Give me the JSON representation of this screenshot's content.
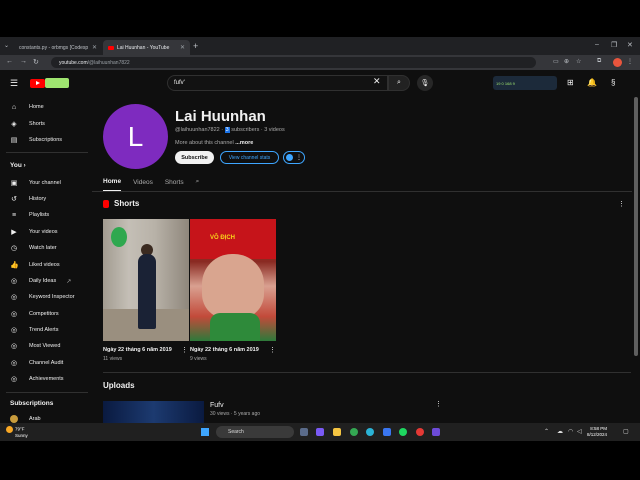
{
  "browser": {
    "tabs": [
      {
        "title": "constants.py - orbmgs [Codesp",
        "active": false
      },
      {
        "title": "Lai Huunhan - YouTube",
        "active": true
      }
    ],
    "new_tab": "+",
    "window_controls": [
      "–",
      "❐",
      "✕"
    ],
    "address": {
      "host": "youtube.com",
      "path": "/@laihuunhan7822"
    }
  },
  "yt_header": {
    "search_query": "fufv'",
    "clear": "✕",
    "ext_stats": "19  0  168  9"
  },
  "sidebar": {
    "top": [
      {
        "label": "Home",
        "icon": "home-icon",
        "glyph": "⌂"
      },
      {
        "label": "Shorts",
        "icon": "shorts-icon",
        "glyph": "◈"
      },
      {
        "label": "Subscriptions",
        "icon": "subscriptions-icon",
        "glyph": "▤"
      }
    ],
    "you_header": "You",
    "you_items": [
      {
        "label": "Your channel",
        "icon": "channel-icon",
        "glyph": "▣"
      },
      {
        "label": "History",
        "icon": "history-icon",
        "glyph": "↺"
      },
      {
        "label": "Playlists",
        "icon": "playlists-icon",
        "glyph": "≡"
      },
      {
        "label": "Your videos",
        "icon": "videos-icon",
        "glyph": "▶"
      },
      {
        "label": "Watch later",
        "icon": "clock-icon",
        "glyph": "◷"
      },
      {
        "label": "Liked videos",
        "icon": "like-icon",
        "glyph": "👍"
      },
      {
        "label": "Daily Ideas",
        "icon": "ideas-icon",
        "glyph": "◎"
      },
      {
        "label": "Keyword Inspector",
        "icon": "keyword-icon",
        "glyph": "◎"
      },
      {
        "label": "Competitors",
        "icon": "competitors-icon",
        "glyph": "◎"
      },
      {
        "label": "Trend Alerts",
        "icon": "trend-icon",
        "glyph": "◎"
      },
      {
        "label": "Most Viewed",
        "icon": "most-viewed-icon",
        "glyph": "◎"
      },
      {
        "label": "Channel Audit",
        "icon": "audit-icon",
        "glyph": "◎"
      },
      {
        "label": "Achievements",
        "icon": "achievements-icon",
        "glyph": "◎"
      }
    ],
    "subs_header": "Subscriptions",
    "subs_items": [
      {
        "label": "Arab"
      }
    ]
  },
  "channel": {
    "avatar_letter": "L",
    "name": "Lai Huunhan",
    "handle": "@laihuunhan7822 · ",
    "subscriber_count": "3",
    "meta_rest": " subscribers · 3 videos",
    "about": "More about this channel ",
    "more": "...more",
    "subscribe": "Subscribe",
    "view_stats": "View channel stats"
  },
  "tabs": [
    "Home",
    "Videos",
    "Shorts"
  ],
  "shorts_section": {
    "heading": "Shorts",
    "items": [
      {
        "title": "Ngày 22 tháng 6 năm 2019",
        "views": "11 views"
      },
      {
        "title": "Ngày 22 tháng 6 năm 2019",
        "views": "9 views",
        "overlay": "VÔ ĐỊCH"
      }
    ]
  },
  "uploads_section": {
    "heading": "Uploads",
    "items": [
      {
        "title": "Fufv",
        "meta": "30 views · 5 years ago"
      }
    ]
  },
  "taskbar": {
    "temp": "79°F",
    "weather": "Sunny",
    "search": "Search",
    "time": "8:58 PM",
    "date": "8/12/2024"
  },
  "colors": {
    "accent": "#3ea6ff",
    "avatar": "#7e2bbf",
    "brand": "#ff0000"
  }
}
